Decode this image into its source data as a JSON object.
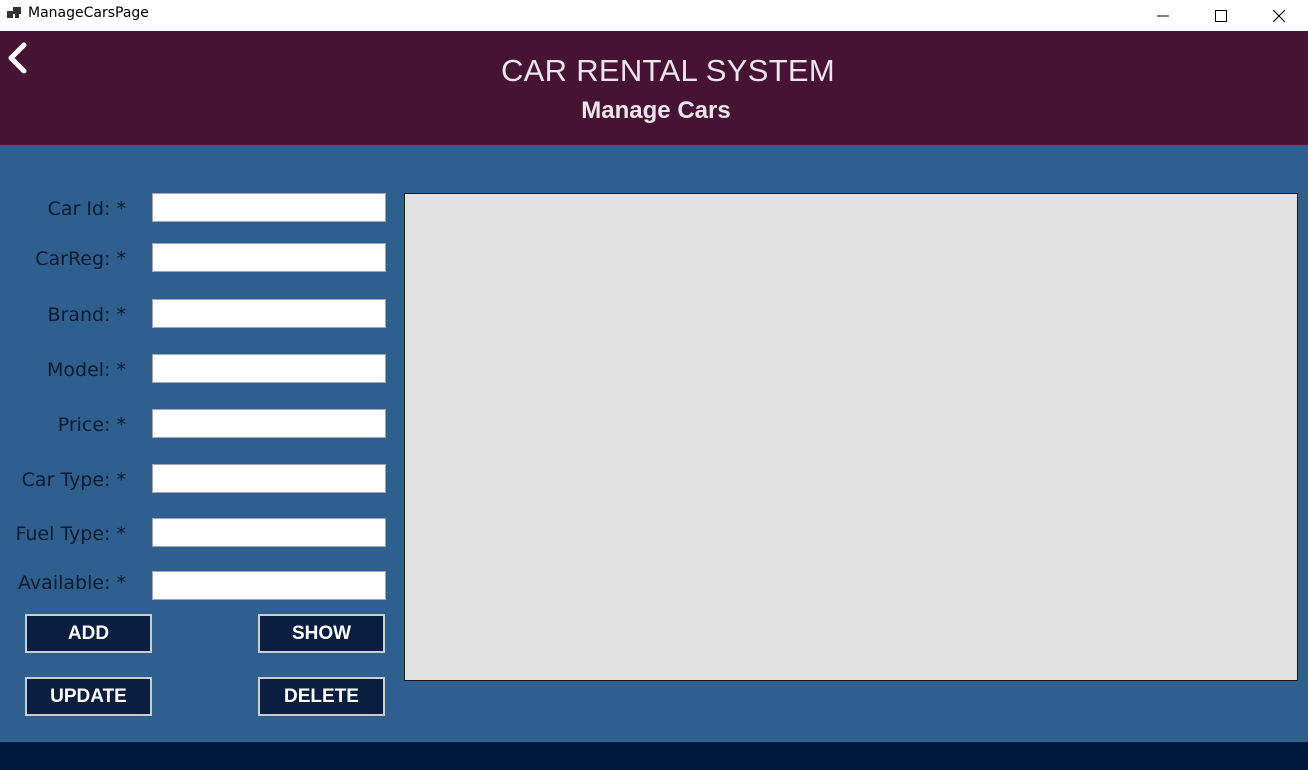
{
  "window": {
    "title": "ManageCarsPage",
    "controls": [
      "minimize-icon",
      "maximize-icon",
      "close-icon"
    ]
  },
  "header": {
    "back_icon": "chevron-left-icon",
    "app_title": "CAR RENTAL SYSTEM",
    "page_title": "Manage Cars",
    "background": "#471335"
  },
  "form": {
    "fields": [
      {
        "label": "Car Id: *",
        "value": ""
      },
      {
        "label": "CarReg: *",
        "value": ""
      },
      {
        "label": "Brand: *",
        "value": ""
      },
      {
        "label": "Model: *",
        "value": ""
      },
      {
        "label": "Price: *",
        "value": ""
      },
      {
        "label": "Car Type: *",
        "value": ""
      },
      {
        "label": "Fuel Type: *",
        "value": ""
      },
      {
        "label": "Available: *",
        "value": ""
      }
    ]
  },
  "actions": {
    "add": "ADD",
    "show": "SHOW",
    "update": "UPDATE",
    "delete": "DELETE",
    "button_color": "#0a1e42"
  },
  "colors": {
    "body_background": "#2e5f8e",
    "footer": "#001a3d",
    "grid_background": "#e1e1e1"
  }
}
